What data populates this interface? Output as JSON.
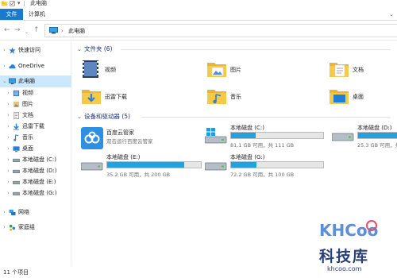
{
  "window": {
    "title": "此电脑"
  },
  "ribbon": {
    "tabs": [
      {
        "label": "文件",
        "active": true
      },
      {
        "label": "计算机",
        "active": false
      }
    ]
  },
  "address": {
    "separator": "›",
    "path": "此电脑"
  },
  "sidebar": {
    "items": [
      {
        "label": "快速访问",
        "icon": "star-icon"
      },
      {
        "label": "OneDrive",
        "icon": "cloud-icon"
      },
      {
        "label": "此电脑",
        "icon": "computer-icon",
        "selected": true
      },
      {
        "label": "视频",
        "icon": "video-folder-icon"
      },
      {
        "label": "图片",
        "icon": "pictures-folder-icon"
      },
      {
        "label": "文档",
        "icon": "documents-folder-icon"
      },
      {
        "label": "迅雷下载",
        "icon": "download-icon"
      },
      {
        "label": "音乐",
        "icon": "music-icon"
      },
      {
        "label": "桌面",
        "icon": "desktop-icon"
      },
      {
        "label": "本地磁盘 (C:)",
        "icon": "drive-icon"
      },
      {
        "label": "本地磁盘 (D:)",
        "icon": "drive-icon"
      },
      {
        "label": "本地磁盘 (E:)",
        "icon": "drive-icon"
      },
      {
        "label": "本地磁盘 (G:)",
        "icon": "drive-icon"
      },
      {
        "label": "网络",
        "icon": "network-icon"
      },
      {
        "label": "家庭组",
        "icon": "homegroup-icon"
      }
    ]
  },
  "groups": {
    "folders": {
      "title": "文件夹 (6)"
    },
    "devices": {
      "title": "设备和驱动器 (5)"
    }
  },
  "folders": [
    {
      "label": "视频",
      "icon": "video-folder-icon"
    },
    {
      "label": "图片",
      "icon": "pictures-folder-icon"
    },
    {
      "label": "文档",
      "icon": "documents-folder-icon"
    },
    {
      "label": "迅雷下载",
      "icon": "download-folder-icon"
    },
    {
      "label": "音乐",
      "icon": "music-folder-icon"
    },
    {
      "label": "桌面",
      "icon": "desktop-folder-icon"
    }
  ],
  "drives": [
    {
      "name": "百度云管家",
      "sub": "双击运行百度云管家",
      "icon": "baidu-cloud-icon",
      "is_app": true
    },
    {
      "name": "本地磁盘 (C:)",
      "size": "81.1 GB 可用，共 111 GB",
      "used_fraction": 0.27,
      "icon": "windows-drive-icon"
    },
    {
      "name": "本地磁盘 (D:)",
      "size": "25.3 GB 可用，共",
      "used_fraction": 0.5,
      "icon": "drive-icon"
    },
    {
      "name": "本地磁盘 (E:)",
      "size": "35.2 GB 可用，共 200 GB",
      "used_fraction": 0.82,
      "icon": "drive-icon"
    },
    {
      "name": "本地磁盘 (G:)",
      "size": "72.2 GB 可用，共 100 GB",
      "used_fraction": 0.28,
      "icon": "drive-icon"
    }
  ],
  "status": {
    "count": "11 个项目"
  },
  "watermark": {
    "logo": "KHCoo",
    "cn": "科技库",
    "url": "khcoo.com"
  },
  "colors": {
    "accent": "#1979ca",
    "selection": "#cce8ff",
    "drive_bar": "#26a0da",
    "folder_yellow": "#f7c948",
    "group_title": "#1e3287"
  }
}
